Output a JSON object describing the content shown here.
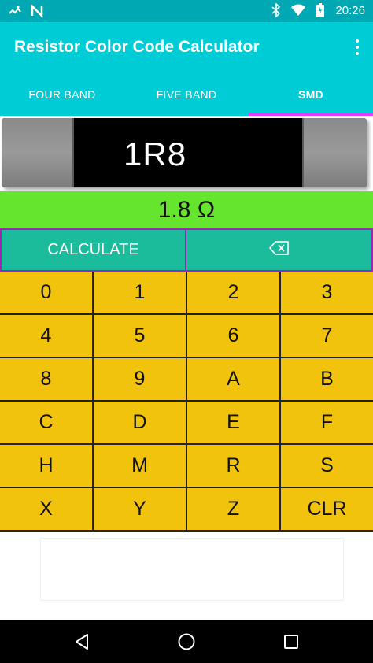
{
  "status_bar": {
    "time": "20:26",
    "icons_left": [
      "weather-icon",
      "notification-n-icon"
    ],
    "icons_right": [
      "bluetooth-icon",
      "wifi-icon",
      "battery-icon"
    ]
  },
  "app_bar": {
    "title": "Resistor Color Code Calculator"
  },
  "tabs": [
    {
      "label": "FOUR BAND",
      "selected": false
    },
    {
      "label": "FIVE BAND",
      "selected": false
    },
    {
      "label": "SMD",
      "selected": true
    }
  ],
  "resistor": {
    "code": "1R8"
  },
  "result": {
    "value": "1.8 Ω"
  },
  "actions": {
    "calculate_label": "CALCULATE",
    "backspace_glyph": "⌫"
  },
  "keypad": {
    "keys": [
      "0",
      "1",
      "2",
      "3",
      "4",
      "5",
      "6",
      "7",
      "8",
      "9",
      "A",
      "B",
      "C",
      "D",
      "E",
      "F",
      "H",
      "M",
      "R",
      "S",
      "X",
      "Y",
      "Z",
      "CLR"
    ]
  },
  "colors": {
    "primary": "#00ccd6",
    "primary_dark": "#00a8b3",
    "tab_indicator": "#e040fb",
    "result_bg": "#66e52f",
    "action_bg": "#1abc9c",
    "key_bg": "#f2c30d"
  }
}
